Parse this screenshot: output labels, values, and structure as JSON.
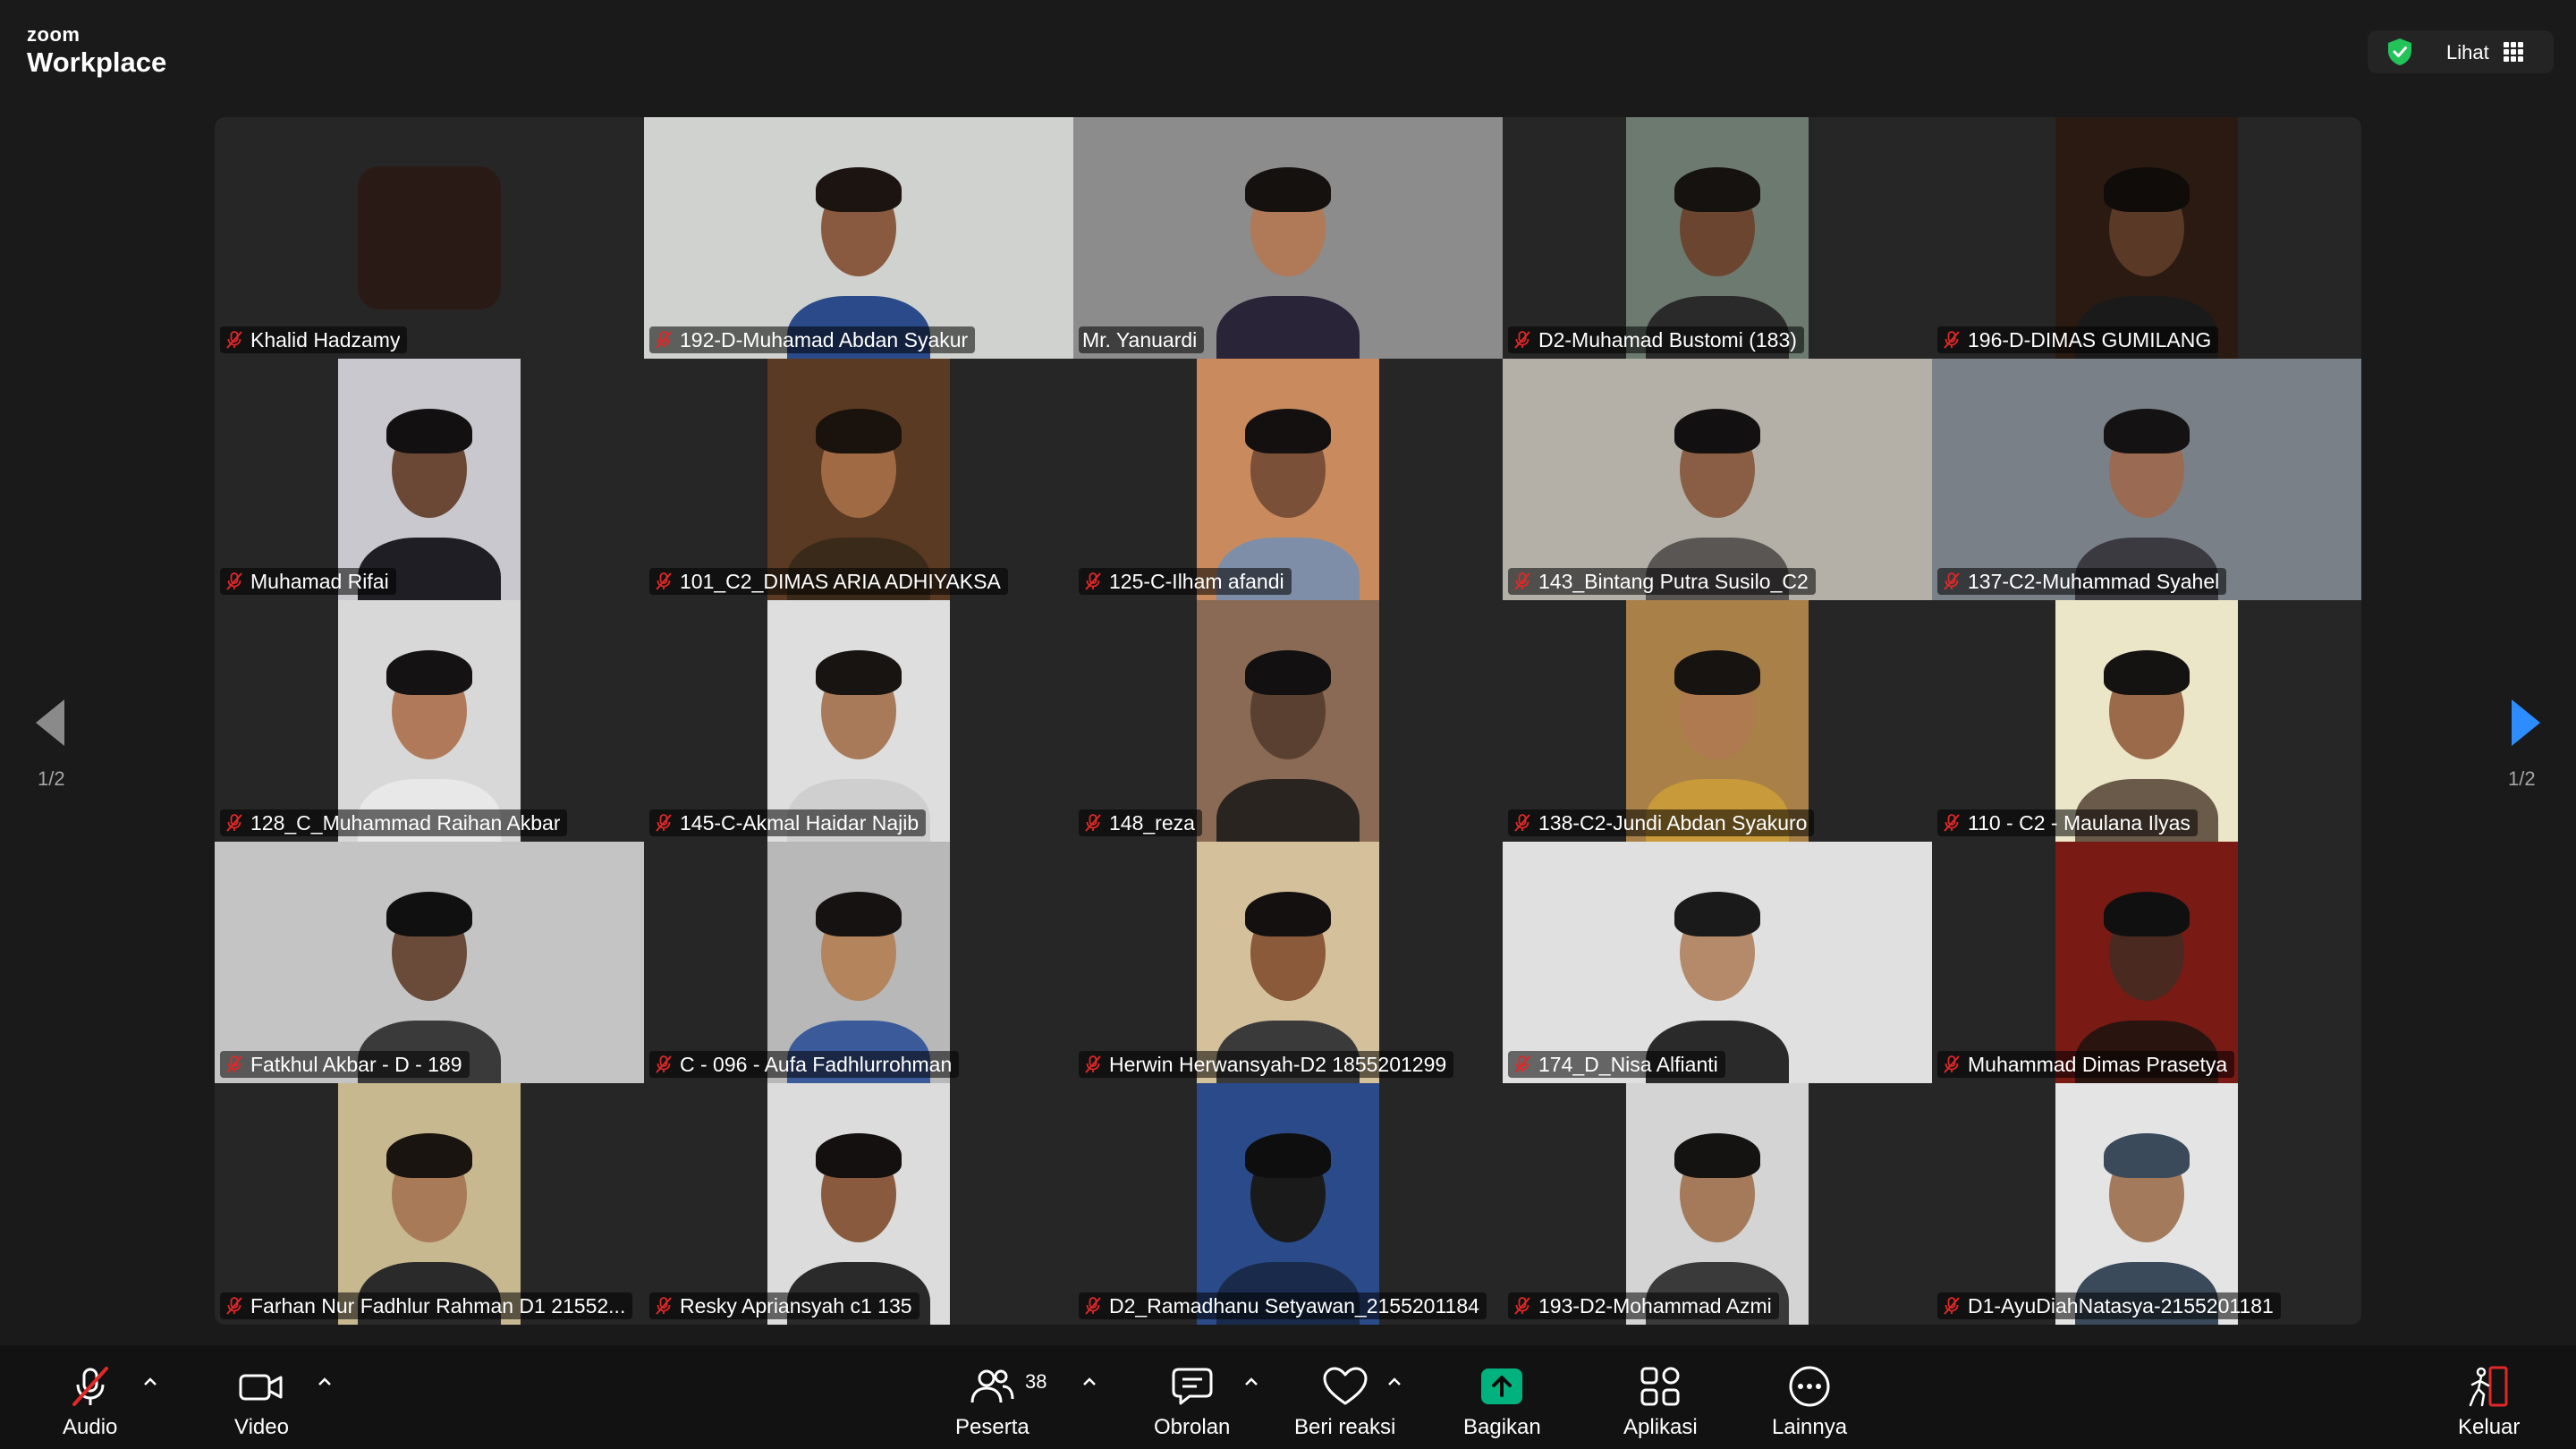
{
  "app": {
    "brand_small": "zoom",
    "brand_big": "Workplace"
  },
  "header": {
    "view_label": "Lihat"
  },
  "pagination": {
    "left": "1/2",
    "right": "1/2"
  },
  "participants": [
    {
      "name": "Khalid Hadzamy",
      "muted": true,
      "video": "avatar"
    },
    {
      "name": "192-D-Muhamad Abdan Syakur",
      "muted": true,
      "video": "full",
      "wall": "#cfd2cf",
      "skin": "#8a5a40",
      "hair": "#1b1410",
      "shirt": "#2b4a8a"
    },
    {
      "name": "Mr. Yanuardi",
      "muted": false,
      "speaking": true,
      "video": "full",
      "wall": "#8c8c8c",
      "skin": "#b07a58",
      "hair": "#15110f",
      "shirt": "#2a2438"
    },
    {
      "name": "D2-Muhamad Bustomi (183)",
      "muted": true,
      "video": "narrow",
      "wall": "#6d7a70",
      "skin": "#6b4530",
      "hair": "#161210",
      "shirt": "#2a2a2a"
    },
    {
      "name": "196-D-DIMAS GUMILANG",
      "muted": true,
      "video": "narrow",
      "wall": "#2b1a12",
      "skin": "#5a3a26",
      "hair": "#100c0a",
      "shirt": "#1a1a1a"
    },
    {
      "name": "Muhamad Rifai",
      "muted": true,
      "video": "narrow",
      "wall": "#c8c8ce",
      "skin": "#6b4836",
      "hair": "#121010",
      "shirt": "#1e1e24"
    },
    {
      "name": "101_C2_DIMAS ARIA ADHIYAKSA",
      "muted": true,
      "video": "narrow",
      "wall": "#5a3a22",
      "skin": "#a06a44",
      "hair": "#1a120c",
      "shirt": "#3a2a1a"
    },
    {
      "name": "125-C-Ilham afandi",
      "muted": true,
      "video": "narrow",
      "wall": "#c98a5e",
      "skin": "#7a5038",
      "hair": "#151010",
      "shirt": "#7e8ea8"
    },
    {
      "name": "143_Bintang Putra Susilo_C2",
      "muted": true,
      "video": "full",
      "wall": "#b4b0a8",
      "skin": "#8a5e44",
      "hair": "#121010",
      "shirt": "#5a5654"
    },
    {
      "name": "137-C2-Muhammad Syahel",
      "muted": true,
      "video": "full",
      "wall": "#7a8088",
      "skin": "#9a6a52",
      "hair": "#141212",
      "shirt": "#3a3a40"
    },
    {
      "name": "128_C_Muhammad Raihan Akbar",
      "muted": true,
      "video": "narrow",
      "wall": "#d8d8d8",
      "skin": "#b07a5a",
      "hair": "#141212",
      "shirt": "#e8e8e8"
    },
    {
      "name": "145-C-Akmal Haidar Najib",
      "muted": true,
      "video": "narrow",
      "wall": "#dedede",
      "skin": "#a87a5a",
      "hair": "#181412",
      "shirt": "#cfcfcf"
    },
    {
      "name": "148_reza",
      "muted": true,
      "video": "narrow",
      "wall": "#8a6a54",
      "skin": "#5a4030",
      "hair": "#121010",
      "shirt": "#2a2420"
    },
    {
      "name": "138-C2-Jundi Abdan Syakuro",
      "muted": true,
      "video": "narrow",
      "wall": "#a88048",
      "skin": "#b07a50",
      "hair": "#171310",
      "shirt": "#c89a3a"
    },
    {
      "name": "110 - C2 - Maulana Ilyas",
      "muted": true,
      "video": "narrow",
      "wall": "#ece6c8",
      "skin": "#9a6a4a",
      "hair": "#151212",
      "shirt": "#6a5a4a"
    },
    {
      "name": "Fatkhul Akbar - D - 189",
      "muted": true,
      "video": "full",
      "wall": "#c4c4c4",
      "skin": "#6a4a38",
      "hair": "#111010",
      "shirt": "#3a3a3a"
    },
    {
      "name": "C - 096 - Aufa Fadhlurrohman",
      "muted": true,
      "video": "narrow",
      "wall": "#b8b8b8",
      "skin": "#b4845c",
      "hair": "#161212",
      "shirt": "#3a5a9a"
    },
    {
      "name": "Herwin Herwansyah-D2 1855201299",
      "muted": true,
      "video": "narrow",
      "wall": "#d4c09a",
      "skin": "#8a5a3a",
      "hair": "#141010",
      "shirt": "#3a3a3a"
    },
    {
      "name": "174_D_Nisa Alfianti",
      "muted": true,
      "video": "full",
      "wall": "#e0e0e0",
      "skin": "#b48a6a",
      "hair": "#1a1a1a",
      "shirt": "#2a2a2a"
    },
    {
      "name": "Muhammad Dimas Prasetya",
      "muted": true,
      "video": "narrow",
      "wall": "#7a1a14",
      "skin": "#4a2a20",
      "hair": "#111010",
      "shirt": "#2a1410"
    },
    {
      "name": "Farhan Nur Fadhlur Rahman D1 21552...",
      "muted": true,
      "video": "narrow",
      "wall": "#c8b890",
      "skin": "#a87a58",
      "hair": "#191410",
      "shirt": "#2a2a2a"
    },
    {
      "name": "Resky Apriansyah c1 135",
      "muted": true,
      "video": "narrow",
      "wall": "#dcdcdc",
      "skin": "#8a5a3e",
      "hair": "#141010",
      "shirt": "#2a2a2a"
    },
    {
      "name": "D2_Ramadhanu Setyawan_2155201184",
      "muted": true,
      "video": "narrow",
      "wall": "#2a4a8a",
      "skin": "#1a1a1a",
      "hair": "#0e0e0e",
      "shirt": "#1a2a4a"
    },
    {
      "name": "193-D2-Mohammad Azmi",
      "muted": true,
      "video": "narrow",
      "wall": "#d4d4d4",
      "skin": "#a47a5a",
      "hair": "#151212",
      "shirt": "#3a3a3a"
    },
    {
      "name": "D1-AyuDiahNatasya-2155201181",
      "muted": true,
      "video": "narrow",
      "wall": "#e4e4e4",
      "skin": "#a47a5c",
      "hair": "#3a4a5a",
      "shirt": "#3a4a5a"
    }
  ],
  "toolbar": {
    "audio": "Audio",
    "video": "Video",
    "participants": "Peserta",
    "participants_count": "38",
    "chat": "Obrolan",
    "react": "Beri reaksi",
    "share": "Bagikan",
    "apps": "Aplikasi",
    "more": "Lainnya",
    "leave": "Keluar"
  },
  "colors": {
    "speaking_border": "#23d959",
    "share_green": "#00b37e",
    "muted_red": "#e02828",
    "leave_red": "#e02828"
  }
}
